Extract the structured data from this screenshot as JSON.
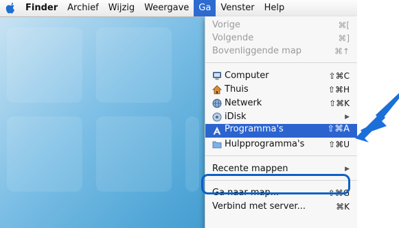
{
  "menubar": {
    "items": [
      "Finder",
      "Archief",
      "Wijzig",
      "Weergave",
      "Ga",
      "Venster",
      "Help"
    ],
    "active": "Ga"
  },
  "menu": {
    "items": [
      {
        "label": "Vorige",
        "shortcut": "⌘[",
        "enabled": false
      },
      {
        "label": "Volgende",
        "shortcut": "⌘]",
        "enabled": false
      },
      {
        "label": "Bovenliggende map",
        "shortcut": "⌘↑",
        "enabled": false
      },
      {
        "label": "Computer",
        "shortcut": "⇧⌘C",
        "enabled": true,
        "icon": "computer-icon"
      },
      {
        "label": "Thuis",
        "shortcut": "⇧⌘H",
        "enabled": true,
        "icon": "home-icon"
      },
      {
        "label": "Netwerk",
        "shortcut": "⇧⌘K",
        "enabled": true,
        "icon": "network-icon"
      },
      {
        "label": "iDisk",
        "shortcut": "▶",
        "enabled": true,
        "icon": "idisk-icon"
      },
      {
        "label": "Programma's",
        "shortcut": "⇧⌘A",
        "enabled": true,
        "icon": "applications-icon",
        "selected": true
      },
      {
        "label": "Hulpprogramma's",
        "shortcut": "⇧⌘U",
        "enabled": true,
        "icon": "utilities-folder-icon"
      },
      {
        "label": "Recente mappen",
        "shortcut": "▶",
        "enabled": true
      },
      {
        "label": "Ga naar map...",
        "shortcut": "⇧⌘G",
        "enabled": true
      },
      {
        "label": "Verbind met server...",
        "shortcut": "⌘K",
        "enabled": true
      }
    ]
  },
  "colors": {
    "highlight": "#2c64cf",
    "arrow": "#1a6fd9"
  }
}
